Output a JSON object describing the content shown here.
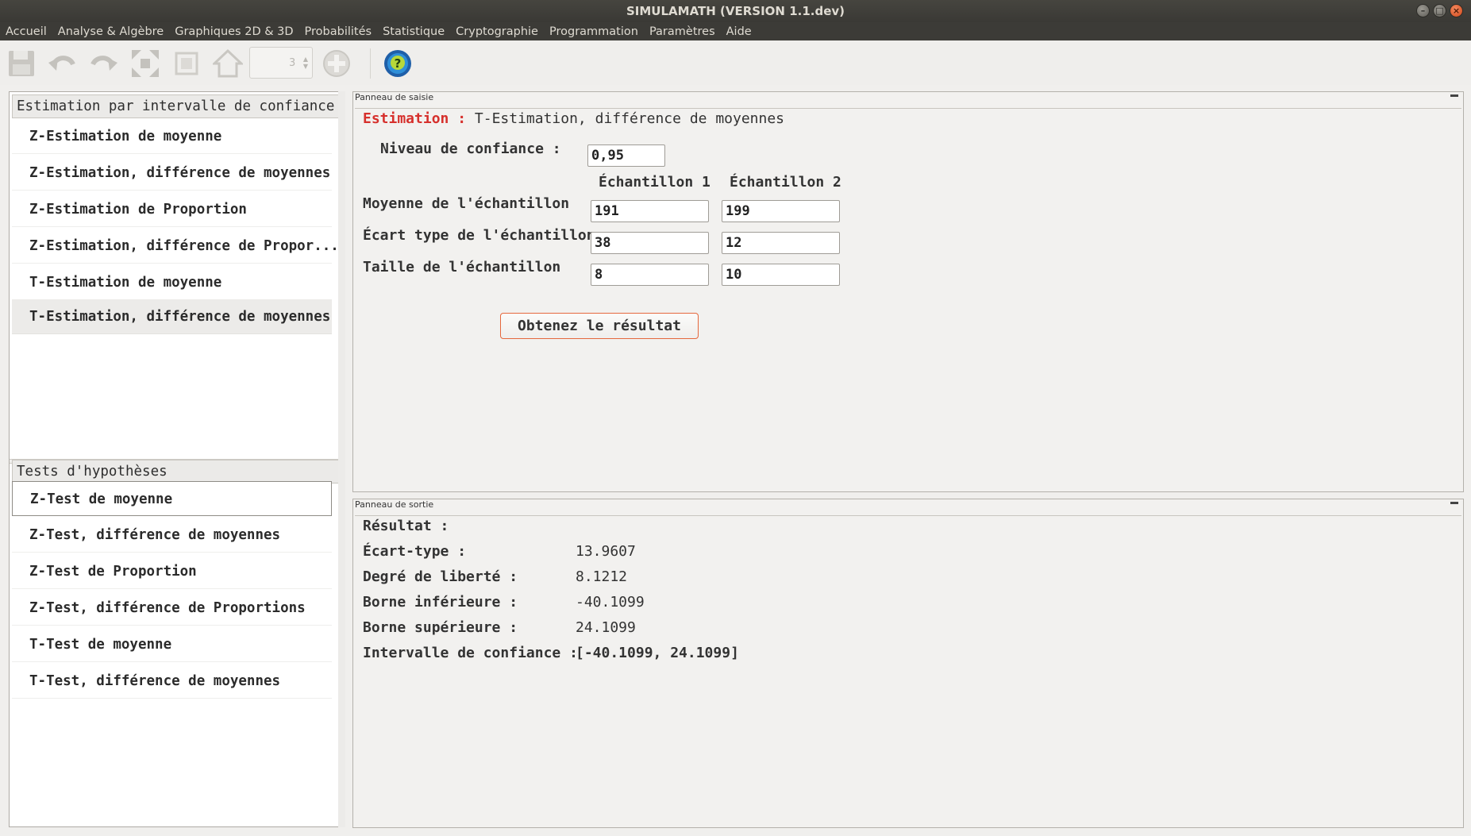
{
  "window": {
    "title": "SIMULAMATH   (VERSION 1.1.dev)"
  },
  "menu": [
    "Accueil",
    "Analyse & Algèbre",
    "Graphiques 2D & 3D",
    "Probabilités",
    "Statistique",
    "Cryptographie",
    "Programmation",
    "Paramètres",
    "Aide"
  ],
  "toolbar": {
    "icons": [
      "save-icon",
      "undo-icon",
      "redo-icon",
      "expand-icon",
      "fit-icon",
      "home-icon",
      "zoom-spinner",
      "add-icon",
      "help-icon"
    ],
    "spin_value": "3"
  },
  "left": {
    "group1_title": "Estimation par intervalle de confiance",
    "group1_items": [
      "Z-Estimation de moyenne",
      "Z-Estimation, différence de moyennes",
      "Z-Estimation de Proportion",
      "Z-Estimation, différence de Propor...",
      "T-Estimation de moyenne",
      "T-Estimation, différence de moyennes"
    ],
    "group2_title": "Tests d'hypothèses",
    "group2_items": [
      "Z-Test de moyenne",
      "Z-Test, différence de moyennes",
      "Z-Test de Proportion",
      "Z-Test, différence de Proportions",
      "T-Test de moyenne",
      "T-Test, différence de moyennes"
    ]
  },
  "input": {
    "panel_title": "Panneau de saisie",
    "heading_prefix": "Estimation :",
    "heading_text": "T-Estimation, différence de moyennes",
    "confidence_label": "Niveau de confiance :",
    "confidence_value": "0,95",
    "col1": "Échantillon 1",
    "col2": "Échantillon 2",
    "mean_label": "Moyenne de l'échantillon",
    "mean1": "191",
    "mean2": "199",
    "sd_label": "Écart type de l'échantillon",
    "sd1": "38",
    "sd2": "12",
    "size_label": "Taille de l'échantillon",
    "size1": "8",
    "size2": "10",
    "button": "Obtenez le résultat"
  },
  "output": {
    "panel_title": "Panneau de sortie",
    "result_label": "Résultat :",
    "rows": [
      {
        "label": "Écart-type :",
        "value": "13.9607"
      },
      {
        "label": "Degré de liberté :",
        "value": "8.1212"
      },
      {
        "label": "Borne inférieure :",
        "value": "-40.1099"
      },
      {
        "label": "Borne supérieure :",
        "value": "24.1099"
      },
      {
        "label": "Intervalle de confiance :",
        "value": "[-40.1099, 24.1099]"
      }
    ]
  },
  "colors": {
    "accent": "#d6302c",
    "button_border": "#e5683d",
    "menubar": "#3c3b37"
  }
}
